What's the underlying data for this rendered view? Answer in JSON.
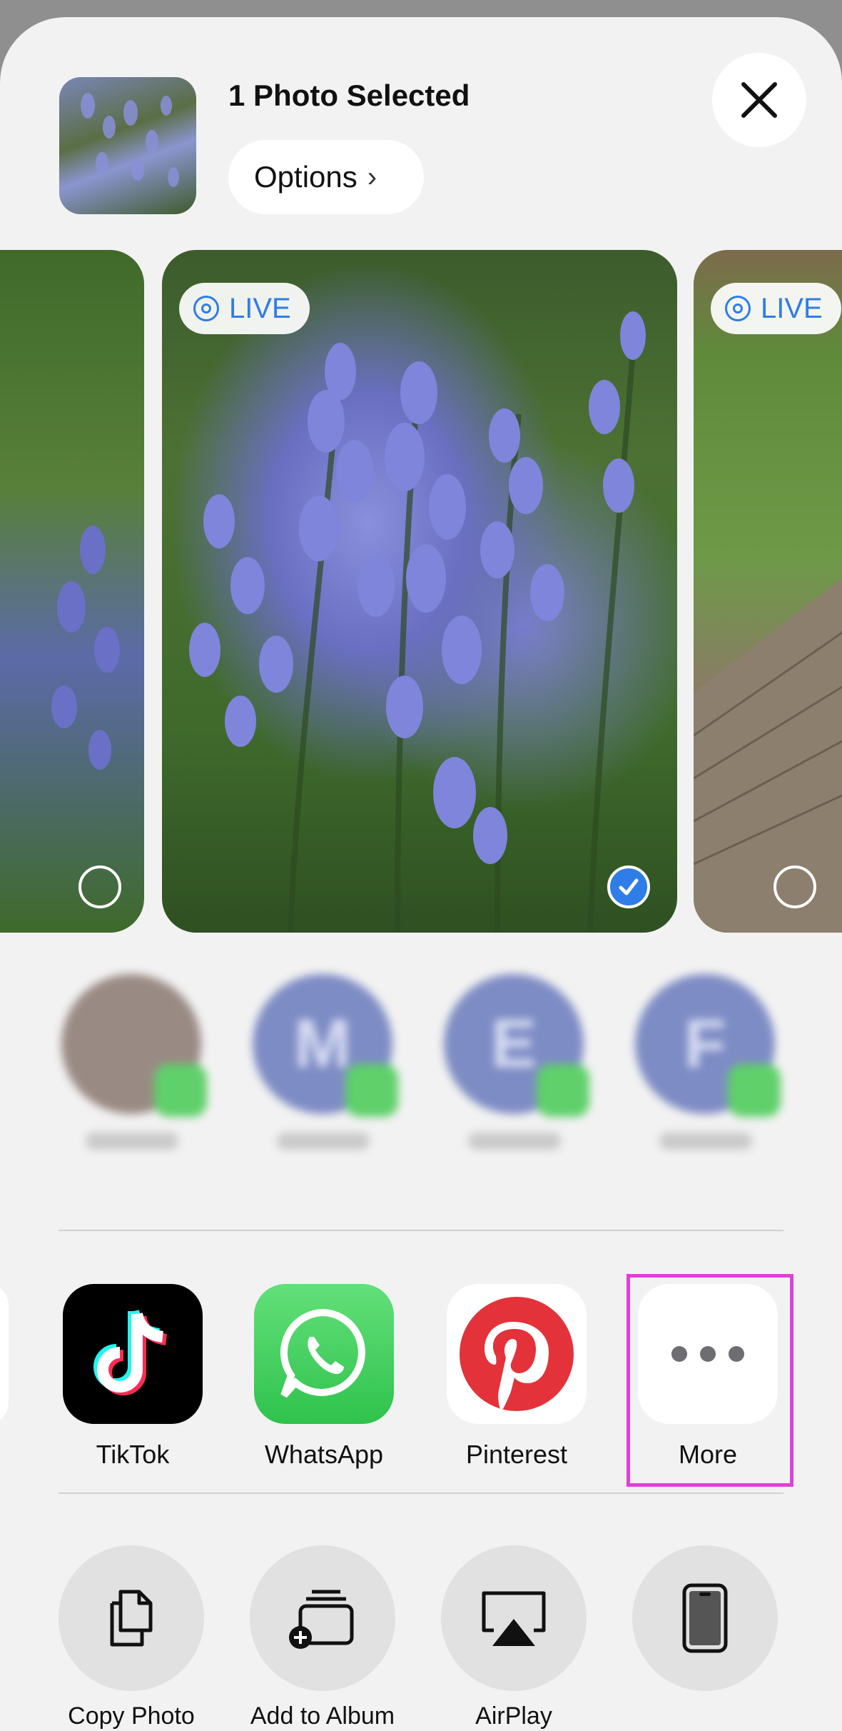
{
  "header": {
    "title": "1 Photo Selected",
    "options_label": "Options",
    "options_chevron": "›"
  },
  "photos": [
    {
      "id": "left",
      "live": false,
      "selected": false
    },
    {
      "id": "main",
      "live": true,
      "live_label": "LIVE",
      "selected": true
    },
    {
      "id": "right",
      "live": true,
      "live_label": "LIVE",
      "selected": false
    }
  ],
  "contacts": [
    {
      "initial": ""
    },
    {
      "initial": "M"
    },
    {
      "initial": "E"
    },
    {
      "initial": "F"
    }
  ],
  "apps": [
    {
      "name": "TikTok",
      "icon": "tiktok-icon"
    },
    {
      "name": "WhatsApp",
      "icon": "whatsapp-icon"
    },
    {
      "name": "Pinterest",
      "icon": "pinterest-icon"
    },
    {
      "name": "More",
      "icon": "more-icon"
    }
  ],
  "actions": [
    {
      "icon": "copy-photo-icon",
      "label": "Copy Photo"
    },
    {
      "icon": "add-to-album-icon",
      "label": "Add to Album"
    },
    {
      "icon": "airplay-icon",
      "label": "AirPlay"
    },
    {
      "icon": "phone-icon",
      "label": ""
    }
  ],
  "colors": {
    "accent": "#2f7de6",
    "highlight": "#e040d8"
  }
}
